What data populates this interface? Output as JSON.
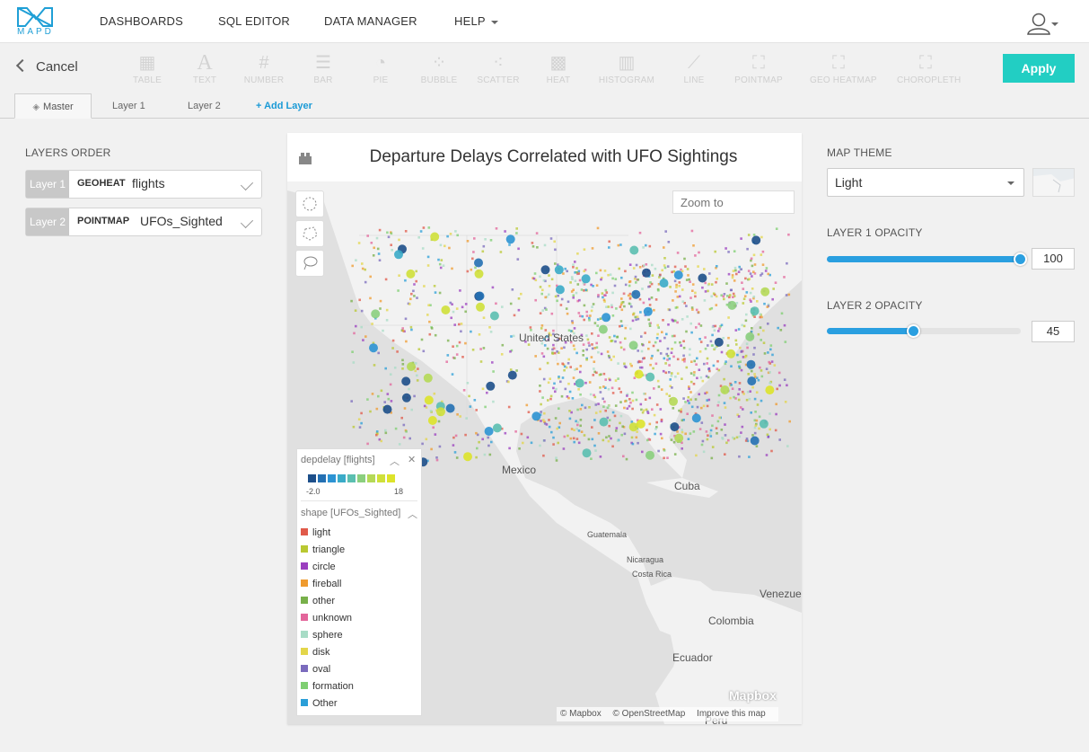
{
  "brand": {
    "logo_text": "MAPD",
    "accent": "#1f9fd6"
  },
  "nav": {
    "items": [
      {
        "label": "DASHBOARDS",
        "has_caret": false
      },
      {
        "label": "SQL EDITOR",
        "has_caret": false
      },
      {
        "label": "DATA MANAGER",
        "has_caret": false
      },
      {
        "label": "HELP",
        "has_caret": true
      }
    ],
    "user_icon": "user-icon"
  },
  "toolbar": {
    "cancel_label": "Cancel",
    "apply_label": "Apply",
    "apply_color": "#22cec3",
    "chart_types": [
      {
        "label": "TABLE",
        "icon": "table-icon"
      },
      {
        "label": "TEXT",
        "icon": "text-icon"
      },
      {
        "label": "NUMBER",
        "icon": "number-icon"
      },
      {
        "label": "BAR",
        "icon": "bar-icon"
      },
      {
        "label": "PIE",
        "icon": "pie-icon"
      },
      {
        "label": "BUBBLE",
        "icon": "bubble-icon"
      },
      {
        "label": "SCATTER",
        "icon": "scatter-icon"
      },
      {
        "label": "HEAT",
        "icon": "heat-icon"
      },
      {
        "label": "HISTOGRAM",
        "icon": "histogram-icon"
      },
      {
        "label": "LINE",
        "icon": "line-icon"
      },
      {
        "label": "POINTMAP",
        "icon": "pointmap-icon"
      },
      {
        "label": "GEO HEATMAP",
        "icon": "geo-heatmap-icon"
      },
      {
        "label": "CHOROPLETH",
        "icon": "choropleth-icon"
      }
    ]
  },
  "tabs": {
    "master": "Master",
    "layer1": "Layer 1",
    "layer2": "Layer 2",
    "add": "+ Add Layer"
  },
  "left_panel": {
    "title": "LAYERS ORDER",
    "layers": [
      {
        "tag": "Layer 1",
        "type": "GEOHEAT",
        "name": "flights"
      },
      {
        "tag": "Layer 2",
        "type": "POINTMAP",
        "name": "UFOs_Sighted"
      }
    ]
  },
  "chart": {
    "title": "Departure Delays Correlated with UFO Sightings",
    "zoom_placeholder": "Zoom to",
    "map_labels": {
      "united_states": "United States",
      "mexico": "Mexico",
      "cuba": "Cuba",
      "guatemala": "Guatemala",
      "nicaragua": "Nicaragua",
      "costa_rica": "Costa Rica",
      "venezuela": "Venezue",
      "colombia": "Colombia",
      "ecuador": "Ecuador",
      "peru": "Peru"
    },
    "mapbox_logo": "Mapbox",
    "attribution": [
      "© Mapbox",
      "© OpenStreetMap",
      "Improve this map"
    ]
  },
  "legend": {
    "depdelay_title": "depdelay [flights]",
    "gradient_colors": [
      "#1d4f8a",
      "#2470b3",
      "#2c93d3",
      "#3aabc8",
      "#5bbfb0",
      "#8bcf7e",
      "#b5d957",
      "#cfe03a",
      "#dde32a"
    ],
    "gradient_min": "-2.0",
    "gradient_max": "18",
    "shape_title": "shape [UFOs_Sighted]",
    "shapes": [
      {
        "label": "light",
        "color": "#e05a4a"
      },
      {
        "label": "triangle",
        "color": "#b9c832"
      },
      {
        "label": "circle",
        "color": "#9b3fbf"
      },
      {
        "label": "fireball",
        "color": "#ef9b2f"
      },
      {
        "label": "other",
        "color": "#78b04a"
      },
      {
        "label": "unknown",
        "color": "#e3669b"
      },
      {
        "label": "sphere",
        "color": "#a8dcc6"
      },
      {
        "label": "disk",
        "color": "#e3d64a"
      },
      {
        "label": "oval",
        "color": "#7b6bbd"
      },
      {
        "label": "formation",
        "color": "#7fcf72"
      },
      {
        "label": "Other",
        "color": "#2b9fd8"
      }
    ]
  },
  "right_panel": {
    "theme_label": "MAP THEME",
    "theme_value": "Light",
    "layer1_opacity_label": "LAYER 1 OPACITY",
    "layer1_opacity": "100",
    "layer1_opacity_fraction": 1.0,
    "layer2_opacity_label": "LAYER 2 OPACITY",
    "layer2_opacity": "45",
    "layer2_opacity_fraction": 0.45
  }
}
